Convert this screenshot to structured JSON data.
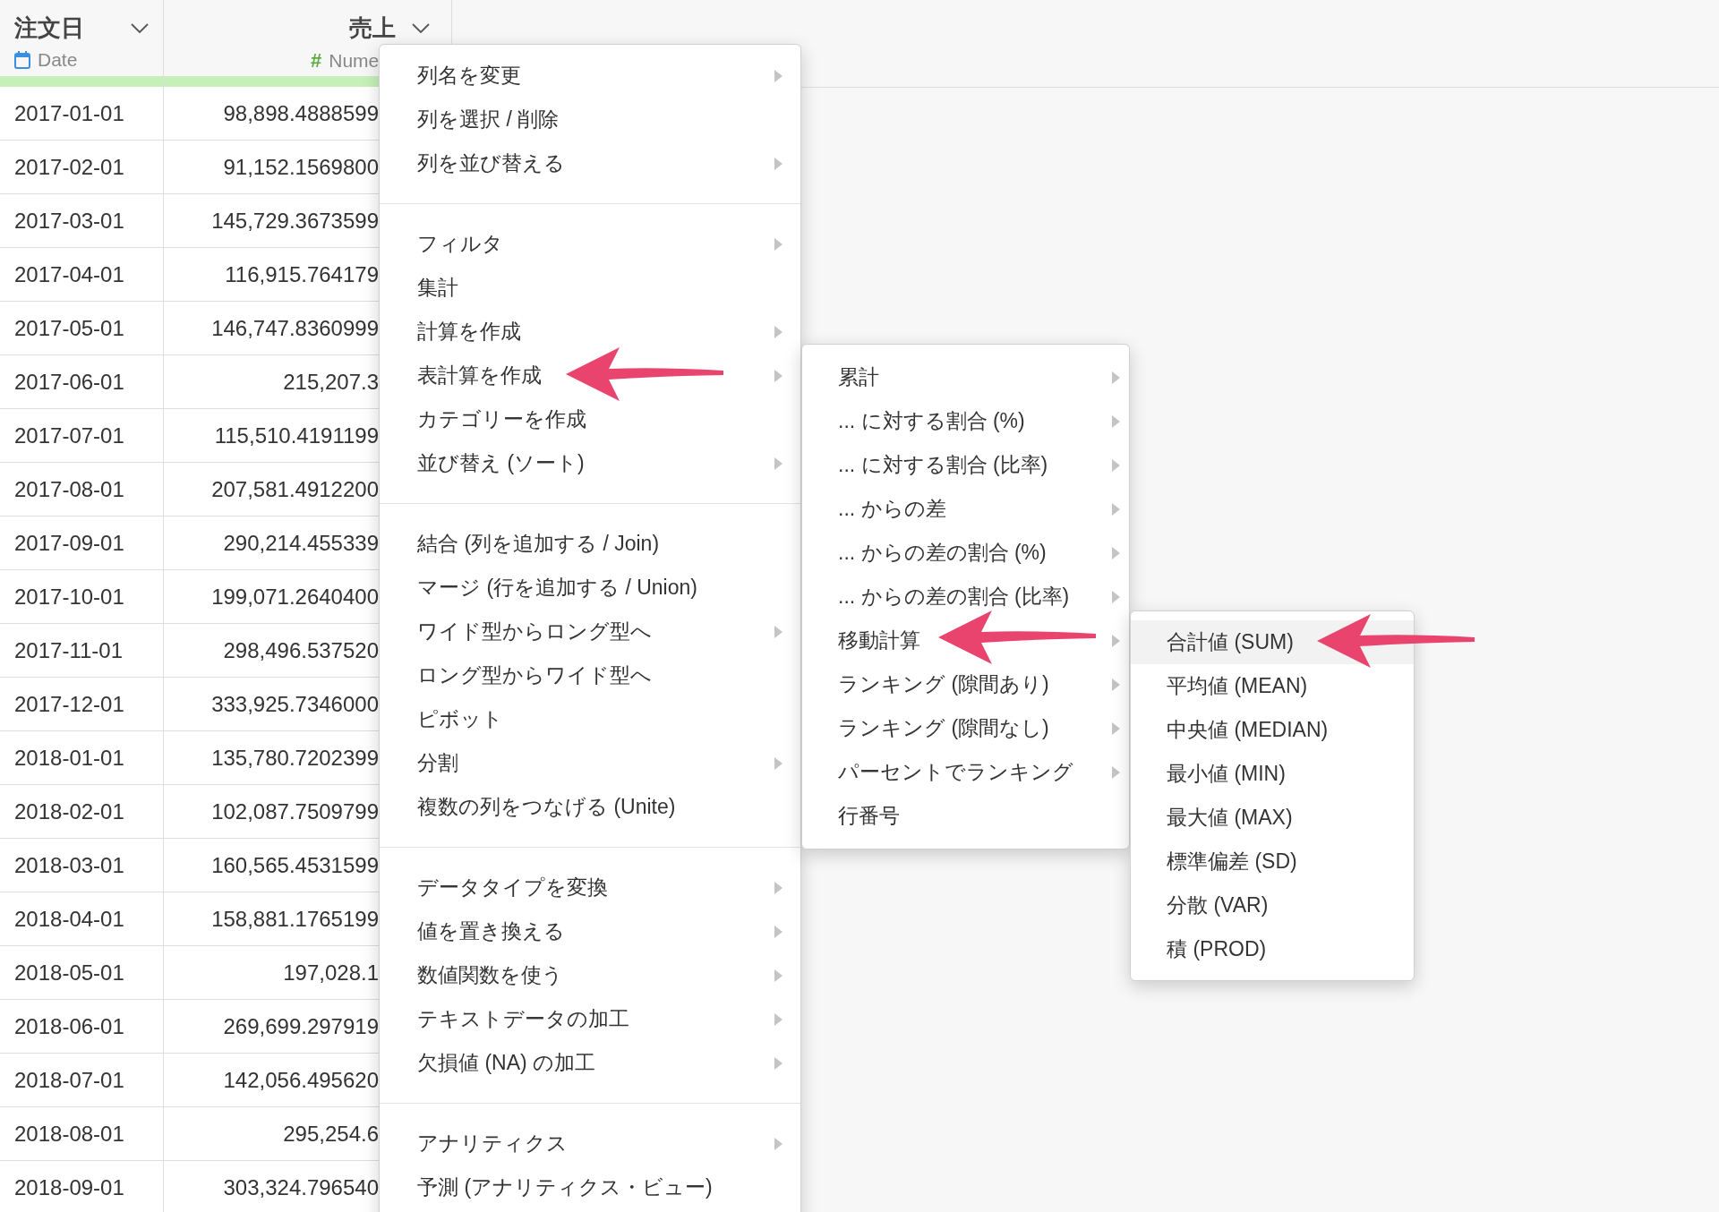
{
  "table": {
    "columns": [
      {
        "name": "注文日",
        "type_label": "Date",
        "kind": "date"
      },
      {
        "name": "売上",
        "type_label": "Nume",
        "kind": "number",
        "icon_text": "#"
      }
    ],
    "rows": [
      [
        "2017-01-01",
        "98,898.4888599"
      ],
      [
        "2017-02-01",
        "91,152.1569800"
      ],
      [
        "2017-03-01",
        "145,729.3673599"
      ],
      [
        "2017-04-01",
        "116,915.764179"
      ],
      [
        "2017-05-01",
        "146,747.8360999"
      ],
      [
        "2017-06-01",
        "215,207.3"
      ],
      [
        "2017-07-01",
        "115,510.4191199"
      ],
      [
        "2017-08-01",
        "207,581.4912200"
      ],
      [
        "2017-09-01",
        "290,214.455339"
      ],
      [
        "2017-10-01",
        "199,071.2640400"
      ],
      [
        "2017-11-01",
        "298,496.537520"
      ],
      [
        "2017-12-01",
        "333,925.7346000"
      ],
      [
        "2018-01-01",
        "135,780.7202399"
      ],
      [
        "2018-02-01",
        "102,087.7509799"
      ],
      [
        "2018-03-01",
        "160,565.4531599"
      ],
      [
        "2018-04-01",
        "158,881.1765199"
      ],
      [
        "2018-05-01",
        "197,028.1"
      ],
      [
        "2018-06-01",
        "269,699.297919"
      ],
      [
        "2018-07-01",
        "142,056.495620"
      ],
      [
        "2018-08-01",
        "295,254.6"
      ],
      [
        "2018-09-01",
        "303,324.796540"
      ]
    ]
  },
  "menu": {
    "groups": [
      [
        {
          "label": "列名を変更",
          "has_submenu": true
        },
        {
          "label": "列を選択 / 削除",
          "has_submenu": false
        },
        {
          "label": "列を並び替える",
          "has_submenu": true
        }
      ],
      [
        {
          "label": "フィルタ",
          "has_submenu": true
        },
        {
          "label": "集計",
          "has_submenu": false
        },
        {
          "label": "計算を作成",
          "has_submenu": true
        },
        {
          "label": "表計算を作成",
          "has_submenu": true
        },
        {
          "label": "カテゴリーを作成",
          "has_submenu": false
        },
        {
          "label": "並び替え (ソート)",
          "has_submenu": true
        }
      ],
      [
        {
          "label": "結合 (列を追加する / Join)",
          "has_submenu": false
        },
        {
          "label": "マージ (行を追加する / Union)",
          "has_submenu": false
        },
        {
          "label": "ワイド型からロング型へ",
          "has_submenu": true
        },
        {
          "label": "ロング型からワイド型へ",
          "has_submenu": false
        },
        {
          "label": "ピボット",
          "has_submenu": false
        },
        {
          "label": "分割",
          "has_submenu": true
        },
        {
          "label": "複数の列をつなげる (Unite)",
          "has_submenu": false
        }
      ],
      [
        {
          "label": "データタイプを変換",
          "has_submenu": true
        },
        {
          "label": "値を置き換える",
          "has_submenu": true
        },
        {
          "label": "数値関数を使う",
          "has_submenu": true
        },
        {
          "label": "テキストデータの加工",
          "has_submenu": true
        },
        {
          "label": "欠損値 (NA) の加工",
          "has_submenu": true
        }
      ],
      [
        {
          "label": "アナリティクス",
          "has_submenu": true
        },
        {
          "label": "予測 (アナリティクス・ビュー)",
          "has_submenu": false
        }
      ]
    ]
  },
  "submenu": {
    "items": [
      {
        "label": "累計",
        "has_submenu": true
      },
      {
        "label": "... に対する割合 (%)",
        "has_submenu": true
      },
      {
        "label": "... に対する割合 (比率)",
        "has_submenu": true
      },
      {
        "label": "... からの差",
        "has_submenu": true
      },
      {
        "label": "... からの差の割合 (%)",
        "has_submenu": true
      },
      {
        "label": "... からの差の割合 (比率)",
        "has_submenu": true
      },
      {
        "label": "移動計算",
        "has_submenu": true
      },
      {
        "label": "ランキング (隙間あり)",
        "has_submenu": true
      },
      {
        "label": "ランキング (隙間なし)",
        "has_submenu": true
      },
      {
        "label": "パーセントでランキング",
        "has_submenu": true
      },
      {
        "label": "行番号",
        "has_submenu": false
      }
    ]
  },
  "submenu_2": {
    "items": [
      {
        "label": "合計値 (SUM)",
        "selected": true
      },
      {
        "label": "平均値 (MEAN)",
        "selected": false
      },
      {
        "label": "中央値 (MEDIAN)",
        "selected": false
      },
      {
        "label": "最小値 (MIN)",
        "selected": false
      },
      {
        "label": "最大値 (MAX)",
        "selected": false
      },
      {
        "label": "標準偏差 (SD)",
        "selected": false
      },
      {
        "label": "分散 (VAR)",
        "selected": false
      },
      {
        "label": "積 (PROD)",
        "selected": false
      }
    ]
  }
}
